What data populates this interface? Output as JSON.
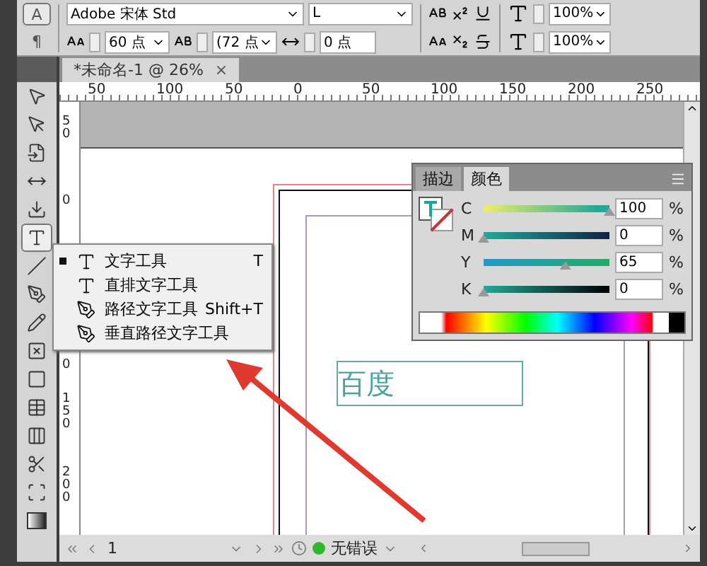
{
  "control_bar": {
    "mode_buttons": [
      {
        "label": "A",
        "selected": true
      },
      {
        "label": "¶",
        "selected": false
      }
    ],
    "font_family": "Adobe 宋体 Std",
    "font_style": "L",
    "font_size": "60 点",
    "leading": "(72 点",
    "tracking": "0 点",
    "vertical_scale": "100%",
    "horizontal_scale": "100%"
  },
  "document_tab": {
    "title": "*未命名-1 @ 26%",
    "close": "×"
  },
  "horizontal_ruler": [
    "50",
    "100",
    "50",
    "0",
    "50",
    "100",
    "150",
    "200",
    "250"
  ],
  "vertical_ruler": [
    "50",
    "0",
    "0",
    "150",
    "200"
  ],
  "tools": [
    {
      "kind": "selection",
      "selected": false
    },
    {
      "kind": "direct",
      "selected": false
    },
    {
      "kind": "page",
      "selected": false
    },
    {
      "kind": "gap",
      "selected": false
    },
    {
      "kind": "collector",
      "selected": false
    },
    {
      "kind": "type",
      "selected": true
    },
    {
      "kind": "line",
      "selected": false
    },
    {
      "kind": "pen",
      "selected": false
    },
    {
      "kind": "pencil",
      "selected": false
    },
    {
      "kind": "frame",
      "selected": false
    },
    {
      "kind": "rectangle",
      "selected": false
    },
    {
      "kind": "table",
      "selected": false
    },
    {
      "kind": "table2",
      "selected": false
    },
    {
      "kind": "scissors",
      "selected": false
    },
    {
      "kind": "transform",
      "selected": false
    },
    {
      "kind": "gradient",
      "selected": false
    }
  ],
  "tool_menu": [
    {
      "kind": "type",
      "label": "文字工具",
      "shortcut": "T",
      "current": true
    },
    {
      "kind": "vertical",
      "label": "直排文字工具",
      "current": false
    },
    {
      "kind": "path",
      "label": "路径文字工具",
      "shortcut": "Shift+T",
      "current": false
    },
    {
      "kind": "vpath",
      "label": "垂直路径文字工具",
      "current": false
    }
  ],
  "canvas_text": "百度",
  "color_panel": {
    "tabs": [
      {
        "label": "描边",
        "selected": false
      },
      {
        "label": "颜色",
        "selected": true
      }
    ],
    "channels": [
      {
        "name": "C",
        "value": "100",
        "unit": "%",
        "level": 1.0
      },
      {
        "name": "M",
        "value": "0",
        "unit": "%",
        "level": 0
      },
      {
        "name": "Y",
        "value": "65",
        "unit": "%",
        "level": 0.65
      },
      {
        "name": "K",
        "value": "0",
        "unit": "%",
        "level": 0
      }
    ]
  },
  "status_bar": {
    "page": "1",
    "preflight": "无错误"
  }
}
